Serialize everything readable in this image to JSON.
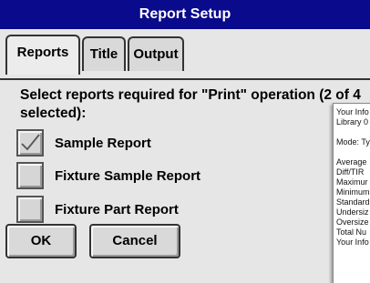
{
  "window": {
    "title": "Report Setup"
  },
  "tabs": [
    {
      "label": "Reports",
      "active": true
    },
    {
      "label": "Title",
      "active": false
    },
    {
      "label": "Output",
      "active": false
    }
  ],
  "prompt": "Select reports required for \"Print\" operation (2 of 4 selected):",
  "reports": [
    {
      "label": "Sample Report",
      "checked": true
    },
    {
      "label": "Fixture Sample Report",
      "checked": false
    },
    {
      "label": "Fixture Part Report",
      "checked": false
    }
  ],
  "buttons": {
    "ok": "OK",
    "cancel": "Cancel"
  },
  "preview_lines": [
    "Your Info",
    "Library 0",
    "",
    "Mode: Ty",
    "",
    "Average",
    "Diff/TIR",
    "Maximur",
    "Minimum",
    "Standard",
    "Undersiz",
    "Oversize",
    "Total Nu",
    "Your Info"
  ],
  "colors": {
    "titlebar": "#0a0a8c",
    "window": "#e6e6e6",
    "checkmark": "#555555"
  }
}
